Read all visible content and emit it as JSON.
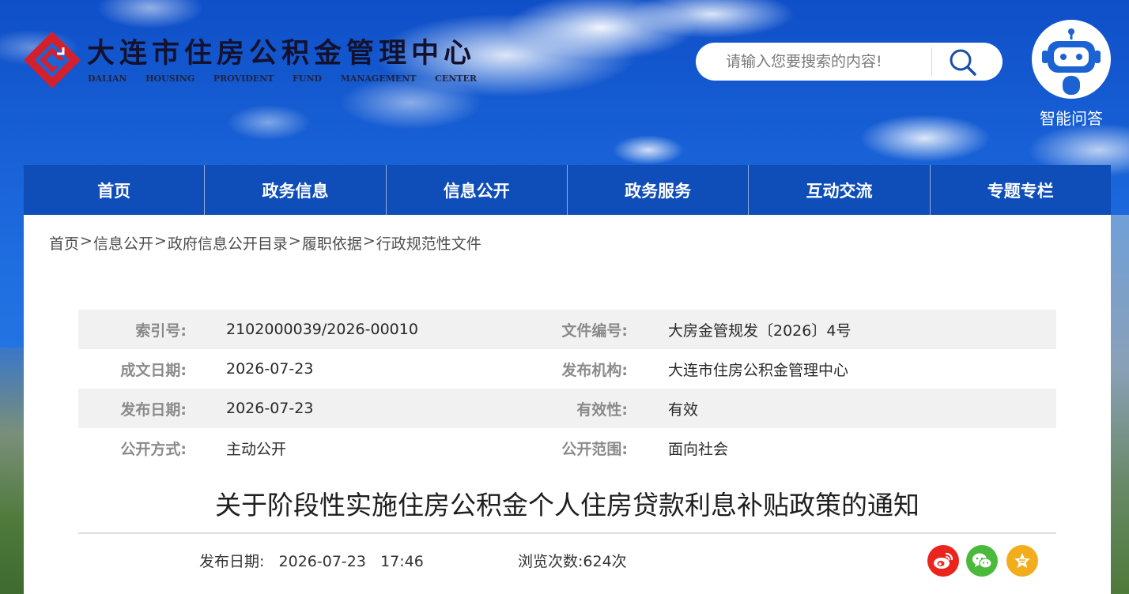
{
  "header": {
    "site_title": "大连市住房公积金管理中心",
    "subtitle_words": [
      "DALIAN",
      "HOUSING",
      "PROVIDENT",
      "FUND",
      "MANAGEMENT",
      "CENTER"
    ],
    "search": {
      "placeholder": "请输入您要搜索的内容!"
    },
    "assistant_label": "智能问答"
  },
  "nav": {
    "items": [
      "首页",
      "政务信息",
      "信息公开",
      "政务服务",
      "互动交流",
      "专题专栏"
    ]
  },
  "breadcrumb": [
    "首页",
    "信息公开",
    "政府信息公开目录",
    "履职依据",
    "行政规范性文件"
  ],
  "breadcrumb_separator": ">",
  "meta": {
    "rows": [
      {
        "k1": "索引号:",
        "v1": "2102000039/2026-00010",
        "k2": "文件编号:",
        "v2": "大房金管规发〔2026〕4号"
      },
      {
        "k1": "成文日期:",
        "v1": "2026-07-23",
        "k2": "发布机构:",
        "v2": "大连市住房公积金管理中心"
      },
      {
        "k1": "发布日期:",
        "v1": "2026-07-23",
        "k2": "有效性:",
        "v2": "有效"
      },
      {
        "k1": "公开方式:",
        "v1": "主动公开",
        "k2": "公开范围:",
        "v2": "面向社会"
      }
    ]
  },
  "article": {
    "title": "关于阶段性实施住房公积金个人住房贷款利息补贴政策的通知",
    "publish_label": "发布日期:",
    "publish_date": "2026-07-23",
    "publish_time": "17:46",
    "views_label": "浏览次数:",
    "views": "624次"
  },
  "share": {
    "icons": [
      "weibo-icon",
      "wechat-icon",
      "star-icon"
    ]
  },
  "colors": {
    "nav_bg": "#0f4db8",
    "weibo": "#e9251d",
    "wechat": "#4bba3c",
    "favorite": "#f1ad1c",
    "logo_red": "#d4202c"
  }
}
